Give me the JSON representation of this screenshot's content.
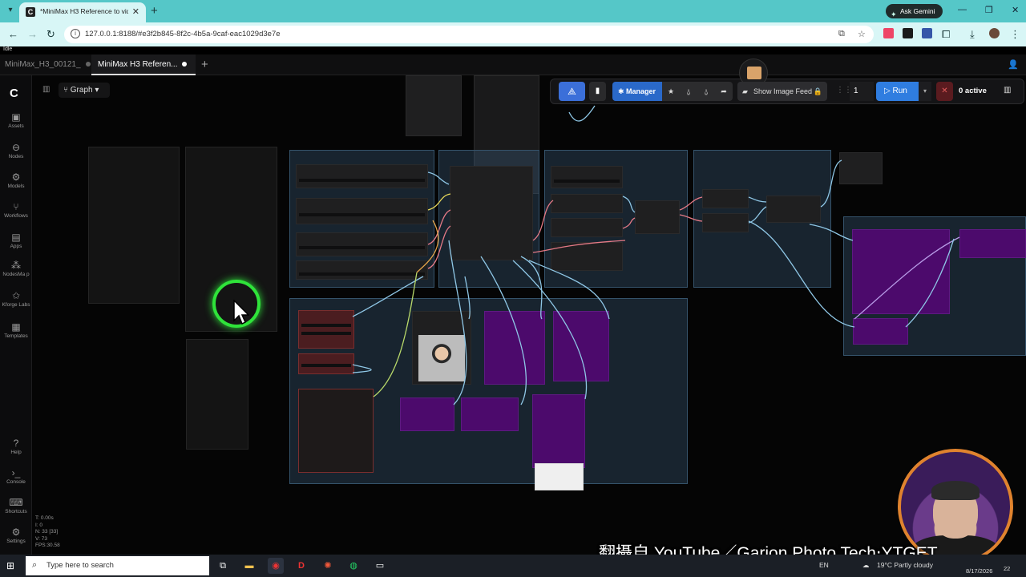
{
  "browser": {
    "tab_title": "*MiniMax H3 Reference to vide",
    "tab_favicon": "C",
    "ask_gemini": "Ask Gemini",
    "url": "127.0.0.1:8188/#e3f2b845-8f2c-4b5a-9caf-eac1029d3e7e"
  },
  "status": {
    "label": "Idle"
  },
  "comfy_tabs": [
    {
      "label": "MiniMax_H3_00121_"
    },
    {
      "label": "MiniMax H3 Referen..."
    }
  ],
  "graph_button": "Graph",
  "sidebar": {
    "items": [
      {
        "label": "Assets",
        "icon": "assets-icon"
      },
      {
        "label": "Nodes",
        "icon": "nodes-icon"
      },
      {
        "label": "Models",
        "icon": "models-icon"
      },
      {
        "label": "Workflows",
        "icon": "workflows-icon"
      },
      {
        "label": "Apps",
        "icon": "apps-icon"
      },
      {
        "label": "NodesMa p",
        "icon": "nodes-map-icon"
      },
      {
        "label": "Kforge Labs",
        "icon": "kforge-icon"
      },
      {
        "label": "Templates",
        "icon": "templates-icon"
      }
    ],
    "bottom": [
      {
        "label": "Help",
        "icon": "help-icon"
      },
      {
        "label": "Console",
        "icon": "console-icon"
      },
      {
        "label": "Shortcuts",
        "icon": "keyboard-icon"
      },
      {
        "label": "Settings",
        "icon": "settings-icon"
      }
    ]
  },
  "toolbar": {
    "manager": "Manager",
    "show_image_feed": "Show Image Feed",
    "queue_count": "1",
    "run": "Run",
    "active": "0 active"
  },
  "stats": {
    "t": "T: 0.00s",
    "i": "I: 0",
    "n": "N: 33 [33]",
    "v": "V: 73",
    "fps": "FPS:30.58"
  },
  "watermark": "翻攝自 YouTube／Garion Photo Tech‧YTGET",
  "taskbar": {
    "search_placeholder": "Type here to search",
    "weather": "19°C  Partly cloudy",
    "lang": "EN",
    "date": "8/17/2026",
    "notifications": "22"
  },
  "colors": {
    "browser_accent": "#55c7c8",
    "run_blue": "#2f7de0",
    "cursor_ring": "#2fe33a",
    "group_purple": "#4c0a6c"
  }
}
